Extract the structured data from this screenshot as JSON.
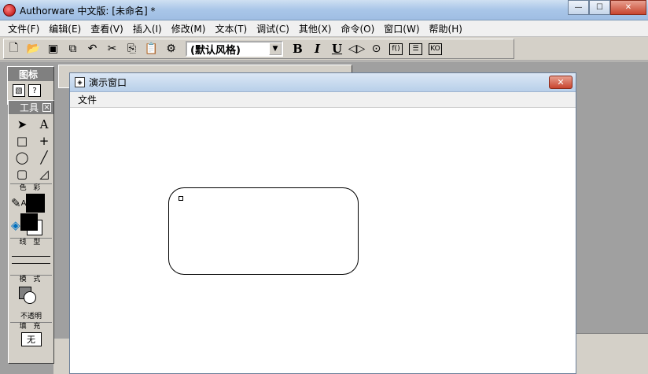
{
  "window": {
    "title": "Authorware 中文版: [未命名] *"
  },
  "menubar": {
    "items": [
      "文件(F)",
      "编辑(E)",
      "查看(V)",
      "插入(I)",
      "修改(M)",
      "文本(T)",
      "调试(C)",
      "其他(X)",
      "命令(O)",
      "窗口(W)",
      "帮助(H)"
    ]
  },
  "toolbar": {
    "style_select": "(默认风格)",
    "bold": "B",
    "italic": "I",
    "underline": "U"
  },
  "icon_palette": {
    "title": "图标"
  },
  "tools_palette": {
    "title": "工具",
    "sections": {
      "color": "色 彩",
      "line": "线 型",
      "mode": "模 式",
      "fill": "填 充"
    },
    "mode_label": "不透明",
    "fill_value": "无"
  },
  "presentation": {
    "title": "演示窗口",
    "menu": [
      "文件"
    ]
  }
}
